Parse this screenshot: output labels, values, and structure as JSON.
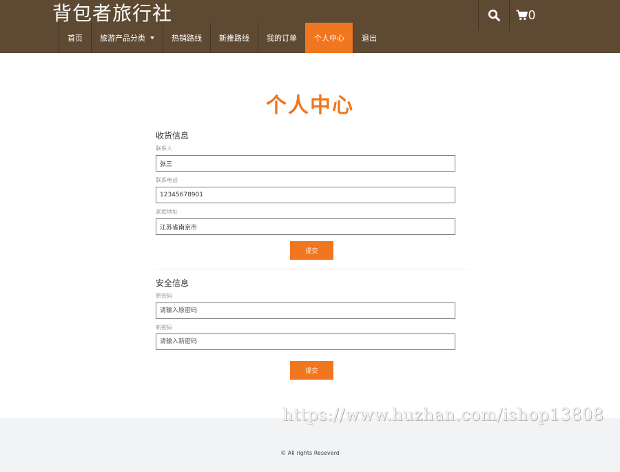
{
  "header": {
    "brand": "背包者旅行社",
    "nav": [
      {
        "label": "首页"
      },
      {
        "label": "旅游产品分类"
      },
      {
        "label": "热销路线"
      },
      {
        "label": "新推路线"
      },
      {
        "label": "我的订单"
      },
      {
        "label": "个人中心"
      },
      {
        "label": "退出"
      }
    ],
    "active_nav": "个人中心",
    "cart_count": "0",
    "icons": {
      "search": "search-icon",
      "cart": "cart-icon",
      "dropdown": "caret-down-icon"
    }
  },
  "page": {
    "title": "个人中心"
  },
  "shipping": {
    "title": "收货信息",
    "contact_label": "联系人",
    "contact_value": "张三",
    "phone_label": "联系电话",
    "phone_value": "12345678901",
    "address_label": "家庭地址",
    "address_value": "江苏省南京市",
    "submit_label": "提交"
  },
  "security": {
    "title": "安全信息",
    "old_label": "原密码",
    "old_placeholder": "请输入原密码",
    "new_label": "新密码",
    "new_placeholder": "请输入新密码",
    "submit_label": "提交"
  },
  "footer": {
    "copyright": "© All rights Reseverd"
  },
  "watermark": "https://www.huzhan.com/ishop13808",
  "colors": {
    "header_bg": "#5e4a33",
    "accent": "#f0761f",
    "footer_bg": "#f1f3f5"
  }
}
